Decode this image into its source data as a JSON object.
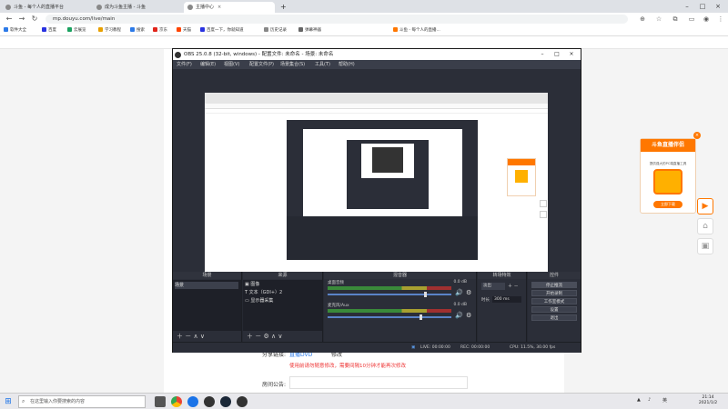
{
  "browser": {
    "tabs": [
      {
        "title": "斗鱼 - 每个人的直播平台",
        "active": false
      },
      {
        "title": "成为斗鱼主播 - 斗鱼",
        "active": false
      },
      {
        "title": "主播中心",
        "active": true
      }
    ],
    "new_tab": "+",
    "url": "mp.douyu.com/live/main",
    "bookmarks": [
      "软件大全",
      "百度",
      "云展览",
      "学习教程",
      "搜索",
      "京东",
      "天猫",
      "百度一下，你就知道",
      "历史记录",
      "弹幕神器",
      "斗鱼 - 每个人的直播..."
    ]
  },
  "obs": {
    "title": "OBS 25.0.8 (32-bit, windows) - 配置文件: 未命名 - 场景: 未命名",
    "menu": [
      "文件(F)",
      "编辑(E)",
      "视图(V)",
      "配置文件(P)",
      "场景集合(S)",
      "工具(T)",
      "帮助(H)"
    ],
    "docks": {
      "scenes": {
        "title": "场景",
        "items": [
          "场景"
        ]
      },
      "sources": {
        "title": "来源",
        "items": [
          "图像",
          "文本（GDI+）2",
          "显示器采集"
        ]
      },
      "mixer": {
        "title": "混音器",
        "channels": [
          {
            "name": "桌面音频",
            "db": "0.0 dB",
            "level": 0.78
          },
          {
            "name": "麦克风/Aux",
            "db": "0.0 dB",
            "level": 0.74
          }
        ]
      },
      "transitions": {
        "title": "转场特效",
        "type": "淡出",
        "duration_label": "时长",
        "duration": "300 ms"
      },
      "controls": {
        "title": "控件",
        "buttons": [
          "停止推流",
          "开始录制",
          "工作室模式",
          "设置",
          "退出"
        ]
      }
    },
    "status": {
      "live": "LIVE: 00:00:00",
      "rec": "REC: 00:00:00",
      "cpu": "CPU: 11.5%, 30.00 fps"
    }
  },
  "page": {
    "promo": {
      "title": "斗鱼直播伴侣",
      "subtitle": "提供强大的PC端直播工具",
      "button": "立即下载"
    },
    "share_label": "分享链接:",
    "share_link": "直播DVD",
    "modify_label": "修改",
    "warning": "使用前请勿随意修改，需要间隔10分钟才能再次修改",
    "record_label": "房间公告:"
  },
  "taskbar": {
    "search_placeholder": "在这里输入你要搜索的内容",
    "ime": "英",
    "time": "21:14",
    "date": "2021/1/2"
  }
}
